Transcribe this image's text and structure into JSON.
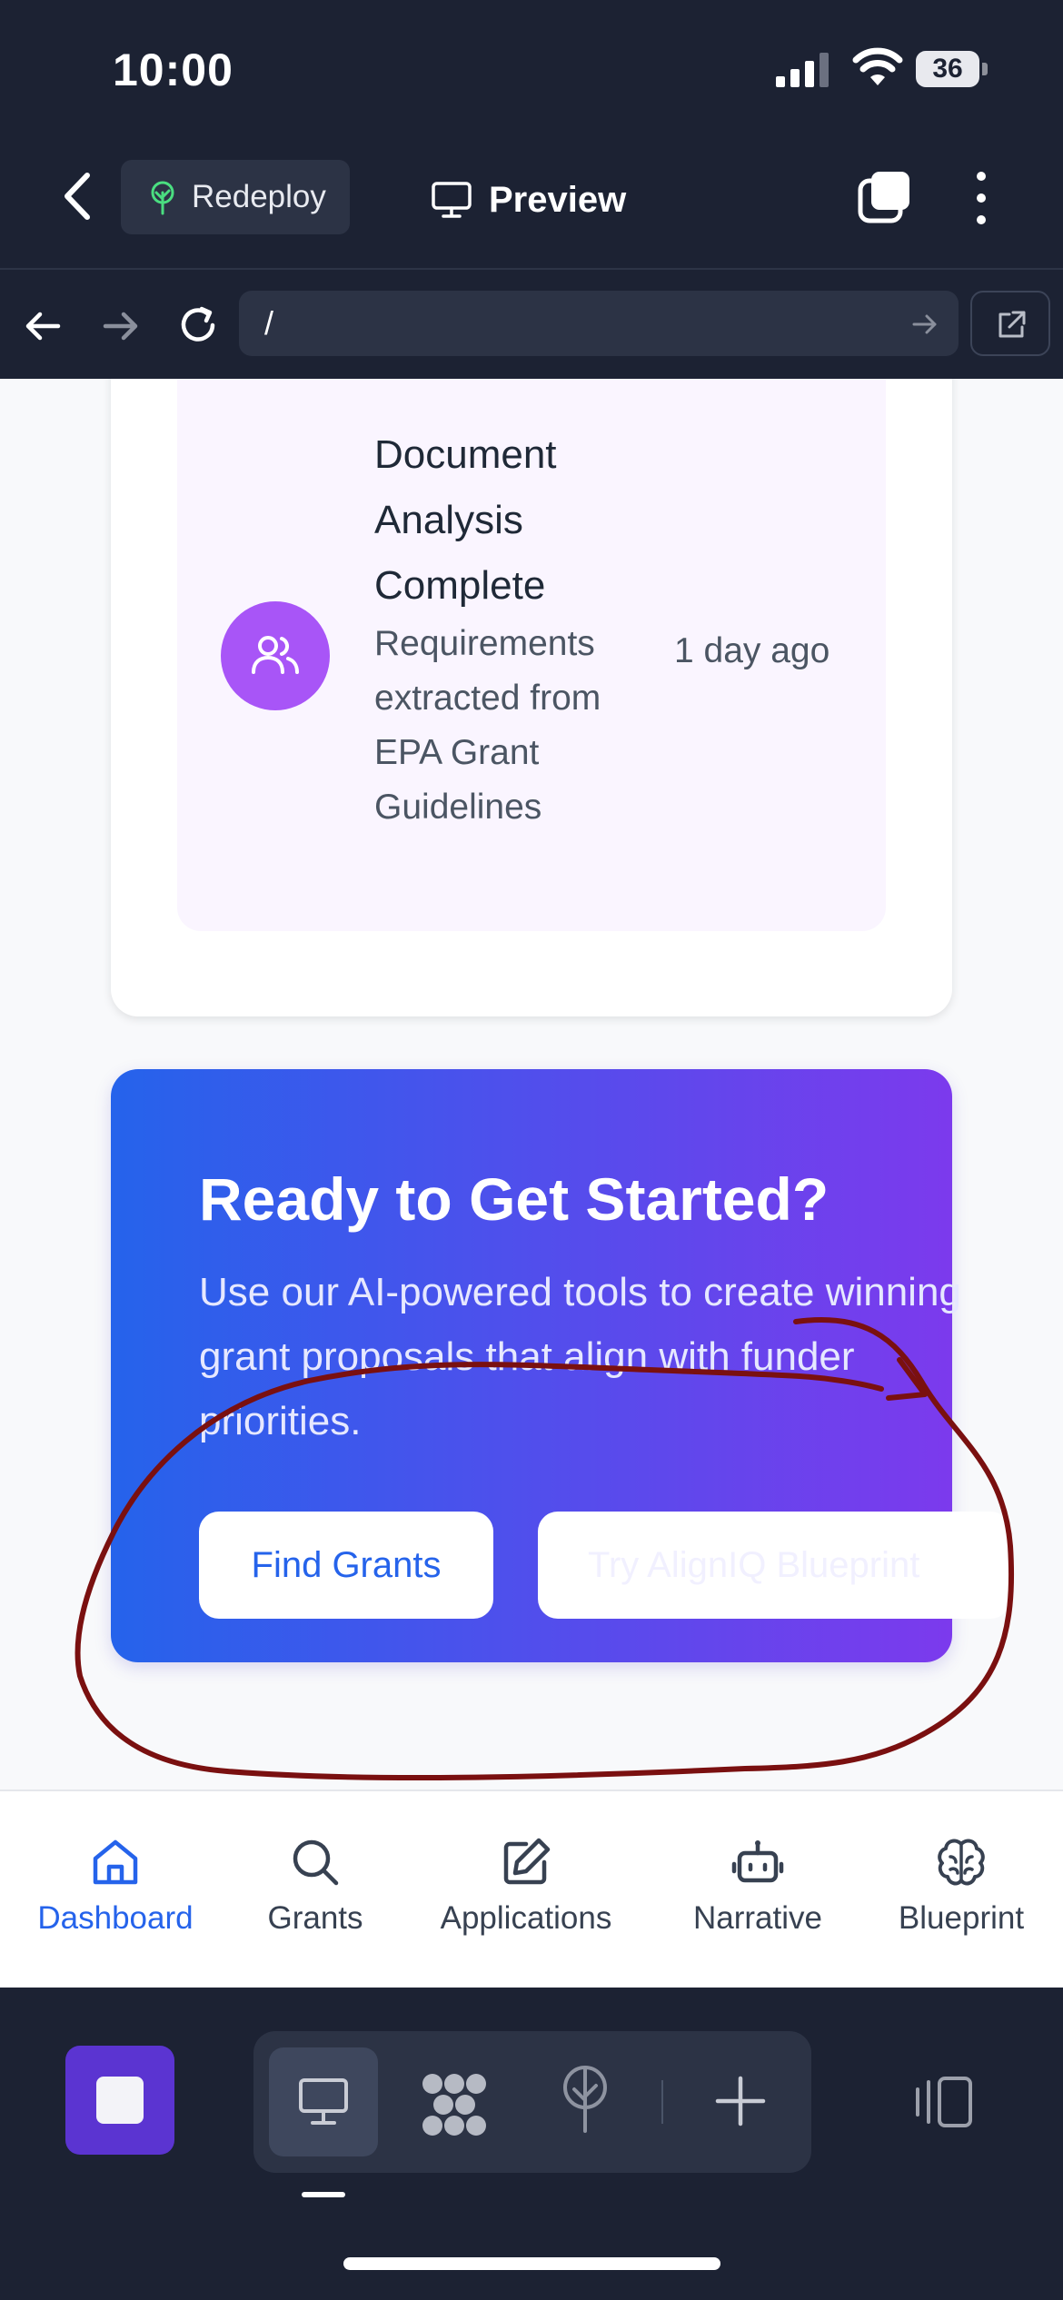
{
  "status_bar": {
    "time": "10:00",
    "battery": "36"
  },
  "header": {
    "redeploy_label": "Redeploy",
    "preview_label": "Preview"
  },
  "browser": {
    "url": "/"
  },
  "activity": {
    "title": "Document Analysis Complete",
    "description": "Requirements extracted from EPA Grant Guidelines",
    "time": "1 day ago"
  },
  "cta": {
    "title": "Ready to Get Started?",
    "text": "Use our AI-powered tools to create winning grant proposals that align with funder priorities.",
    "primary_button": "Find Grants",
    "secondary_button": "Try AlignIQ Blueprint"
  },
  "bottom_nav": {
    "active": "Dashboard",
    "items": [
      {
        "label": "Dashboard",
        "icon": "home-icon"
      },
      {
        "label": "Grants",
        "icon": "search-icon"
      },
      {
        "label": "Applications",
        "icon": "edit-icon"
      },
      {
        "label": "Narrative",
        "icon": "robot-icon"
      },
      {
        "label": "Blueprint",
        "icon": "brain-icon"
      }
    ]
  },
  "colors": {
    "dark_bg": "#1c2233",
    "primary_blue": "#2563eb",
    "purple": "#7c3aed",
    "avatar_purple": "#a855f7",
    "dock_purple": "#5b34d1",
    "annotation_red": "#7a1010"
  }
}
